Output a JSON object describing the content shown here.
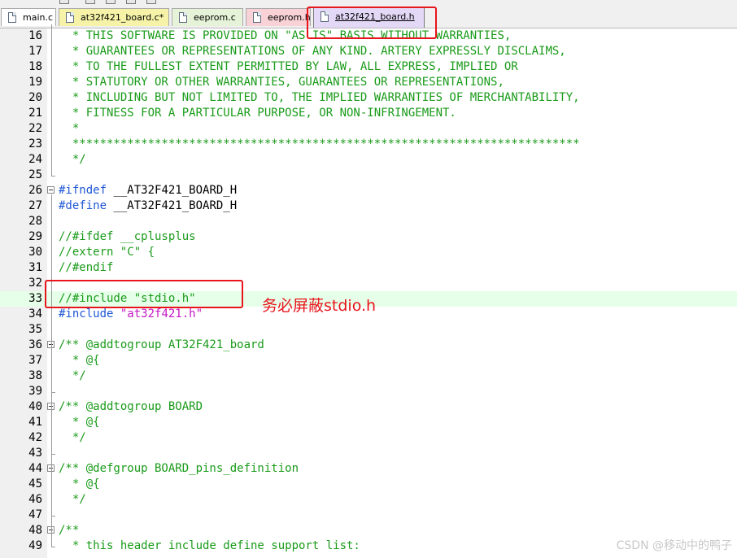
{
  "tabs": [
    {
      "label": "main.c",
      "color": "#ffffff",
      "active": false
    },
    {
      "label": "at32f421_board.c*",
      "color": "#f6f3a8",
      "active": false
    },
    {
      "label": "eeprom.c",
      "color": "#e6f3d8",
      "active": false
    },
    {
      "label": "eeprom.h",
      "color": "#f8d2d6",
      "active": false
    },
    {
      "label": "at32f421_board.h",
      "color": "#e3d8f6",
      "active": true
    }
  ],
  "lines": [
    {
      "num": "16",
      "segs": [
        {
          "t": "  * THIS SOFTWARE IS PROVIDED ON \"AS IS\" BASIS WITHOUT WARRANTIES,",
          "c": "comment"
        }
      ]
    },
    {
      "num": "17",
      "segs": [
        {
          "t": "  * GUARANTEES OR REPRESENTATIONS OF ANY KIND. ARTERY EXPRESSLY DISCLAIMS,",
          "c": "comment"
        }
      ]
    },
    {
      "num": "18",
      "segs": [
        {
          "t": "  * TO THE FULLEST EXTENT PERMITTED BY LAW, ALL EXPRESS, IMPLIED OR",
          "c": "comment"
        }
      ]
    },
    {
      "num": "19",
      "segs": [
        {
          "t": "  * STATUTORY OR OTHER WARRANTIES, GUARANTEES OR REPRESENTATIONS,",
          "c": "comment"
        }
      ]
    },
    {
      "num": "20",
      "segs": [
        {
          "t": "  * INCLUDING BUT NOT LIMITED TO, THE IMPLIED WARRANTIES OF MERCHANTABILITY,",
          "c": "comment"
        }
      ]
    },
    {
      "num": "21",
      "segs": [
        {
          "t": "  * FITNESS FOR A PARTICULAR PURPOSE, OR NON-INFRINGEMENT.",
          "c": "comment"
        }
      ]
    },
    {
      "num": "22",
      "segs": [
        {
          "t": "  *",
          "c": "comment"
        }
      ]
    },
    {
      "num": "23",
      "segs": [
        {
          "t": "  **************************************************************************",
          "c": "comment"
        }
      ]
    },
    {
      "num": "24",
      "segs": [
        {
          "t": "  */",
          "c": "comment"
        }
      ]
    },
    {
      "num": "25",
      "segs": []
    },
    {
      "num": "26",
      "segs": [
        {
          "t": "#ifndef",
          "c": "pre"
        },
        {
          "t": " __AT32F421_BOARD_H",
          "c": "plain"
        }
      ]
    },
    {
      "num": "27",
      "segs": [
        {
          "t": "#define",
          "c": "pre"
        },
        {
          "t": " __AT32F421_BOARD_H",
          "c": "plain"
        }
      ]
    },
    {
      "num": "28",
      "segs": []
    },
    {
      "num": "29",
      "segs": [
        {
          "t": "//#ifdef __cplusplus",
          "c": "comment"
        }
      ]
    },
    {
      "num": "30",
      "segs": [
        {
          "t": "//extern \"C\" {",
          "c": "comment"
        }
      ]
    },
    {
      "num": "31",
      "segs": [
        {
          "t": "//#endif",
          "c": "comment"
        }
      ]
    },
    {
      "num": "32",
      "segs": []
    },
    {
      "num": "33",
      "segs": [
        {
          "t": "//#include \"stdio.h\"",
          "c": "comment"
        }
      ]
    },
    {
      "num": "34",
      "segs": [
        {
          "t": "#include",
          "c": "pre"
        },
        {
          "t": " ",
          "c": "plain"
        },
        {
          "t": "\"at32f421.h\"",
          "c": "str"
        }
      ]
    },
    {
      "num": "35",
      "segs": []
    },
    {
      "num": "36",
      "segs": [
        {
          "t": "/** @addtogroup AT32F421_board",
          "c": "comment"
        }
      ]
    },
    {
      "num": "37",
      "segs": [
        {
          "t": "  * @{",
          "c": "comment"
        }
      ]
    },
    {
      "num": "38",
      "segs": [
        {
          "t": "  */",
          "c": "comment"
        }
      ]
    },
    {
      "num": "39",
      "segs": []
    },
    {
      "num": "40",
      "segs": [
        {
          "t": "/** @addtogroup BOARD",
          "c": "comment"
        }
      ]
    },
    {
      "num": "41",
      "segs": [
        {
          "t": "  * @{",
          "c": "comment"
        }
      ]
    },
    {
      "num": "42",
      "segs": [
        {
          "t": "  */",
          "c": "comment"
        }
      ]
    },
    {
      "num": "43",
      "segs": []
    },
    {
      "num": "44",
      "segs": [
        {
          "t": "/** @defgroup BOARD_pins_definition",
          "c": "comment"
        }
      ]
    },
    {
      "num": "45",
      "segs": [
        {
          "t": "  * @{",
          "c": "comment"
        }
      ]
    },
    {
      "num": "46",
      "segs": [
        {
          "t": "  */",
          "c": "comment"
        }
      ]
    },
    {
      "num": "47",
      "segs": []
    },
    {
      "num": "48",
      "segs": [
        {
          "t": "/**",
          "c": "comment"
        }
      ]
    },
    {
      "num": "49",
      "segs": [
        {
          "t": "  * this header include define support list:",
          "c": "comment"
        }
      ]
    }
  ],
  "annotation": "务必屏蔽stdio.h",
  "watermark": "CSDN @移动中的鸭子",
  "colors": {
    "comment": "#1a9b1a",
    "preprocessor": "#1f57d6",
    "string": "#c418c4",
    "annotation": "#e8151c",
    "highlight_line": "#e6ffe9"
  }
}
